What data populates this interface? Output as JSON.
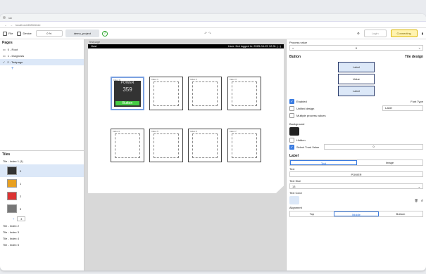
{
  "browser": {
    "tab_title": "ide",
    "url": "localhost:8080/#/ide"
  },
  "toolbar": {
    "file": "File",
    "device": "Device",
    "zoom": "0 %",
    "project": "demo_project",
    "help": "?",
    "login": "Login",
    "connect": "Connecting"
  },
  "pages": {
    "title": "Pages",
    "items": [
      "0 - Root",
      "1 - Diagnosis",
      "2 - Testpage"
    ]
  },
  "tiles": {
    "title": "Tiles",
    "group_open": "Tile - Index 1 (1)",
    "rows": [
      "0",
      "1",
      "2",
      "3"
    ],
    "step_value": "4",
    "groups": [
      "Tile - Index 2",
      "Tile - Index 3",
      "Tile - Index 4",
      "Tile - Index 5"
    ]
  },
  "canvas": {
    "label": "Testpage",
    "host": "Host",
    "status": "User: Not logged in: 2025-04-29 12:31 (...)",
    "tile_labels": [
      "Index 0",
      "Index 1",
      "Index 2",
      "Index 3",
      "Index 4",
      "Index 5",
      "Index 6",
      "Index 7"
    ],
    "power_title": "POWER",
    "power_value": "359",
    "power_button": "Button"
  },
  "props": {
    "process_value_title": "Process value",
    "process_value": "0",
    "button_title": "Button",
    "design": "Tile design",
    "preview": [
      "Label",
      "Value",
      "Label"
    ],
    "enabled": "Enabled",
    "unified": "Unified design",
    "multiple": "Multiple process values",
    "fontype": "Font Type",
    "fontype_value": "Label",
    "background": "Background",
    "hidden": "Hidden",
    "select_trust": "Select Trust Value",
    "trust_value": "0",
    "label_title": "Label",
    "tab_text": "Text",
    "tab_image": "Image",
    "text_title": "Text",
    "text_value": "POWER",
    "text_size_title": "Text Size",
    "text_size": "13",
    "text_color": "Text Color",
    "alignment": "Alignment",
    "align": [
      "Top",
      "Middle",
      "Bottom"
    ]
  }
}
